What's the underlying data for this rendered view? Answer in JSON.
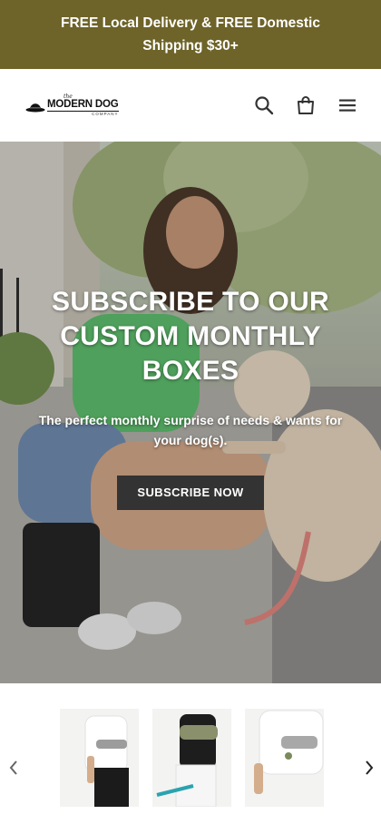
{
  "announcement": {
    "text": "FREE Local Delivery & FREE Domestic Shipping $30+"
  },
  "header": {
    "logo": {
      "small": "the",
      "main": "MODERN DOG",
      "sub": "COMPANY"
    },
    "icons": [
      "search-icon",
      "shopping-bag-icon",
      "hamburger-menu-icon"
    ]
  },
  "hero": {
    "title": "SUBSCRIBE TO OUR CUSTOM MONTHLY BOXES",
    "subtitle": "The perfect monthly surprise of needs & wants for your dog(s).",
    "button_label": "SUBSCRIBE NOW"
  },
  "colors": {
    "announcement_bg": "#6e6328",
    "button_bg": "#333333",
    "text_light": "#ffffff"
  }
}
